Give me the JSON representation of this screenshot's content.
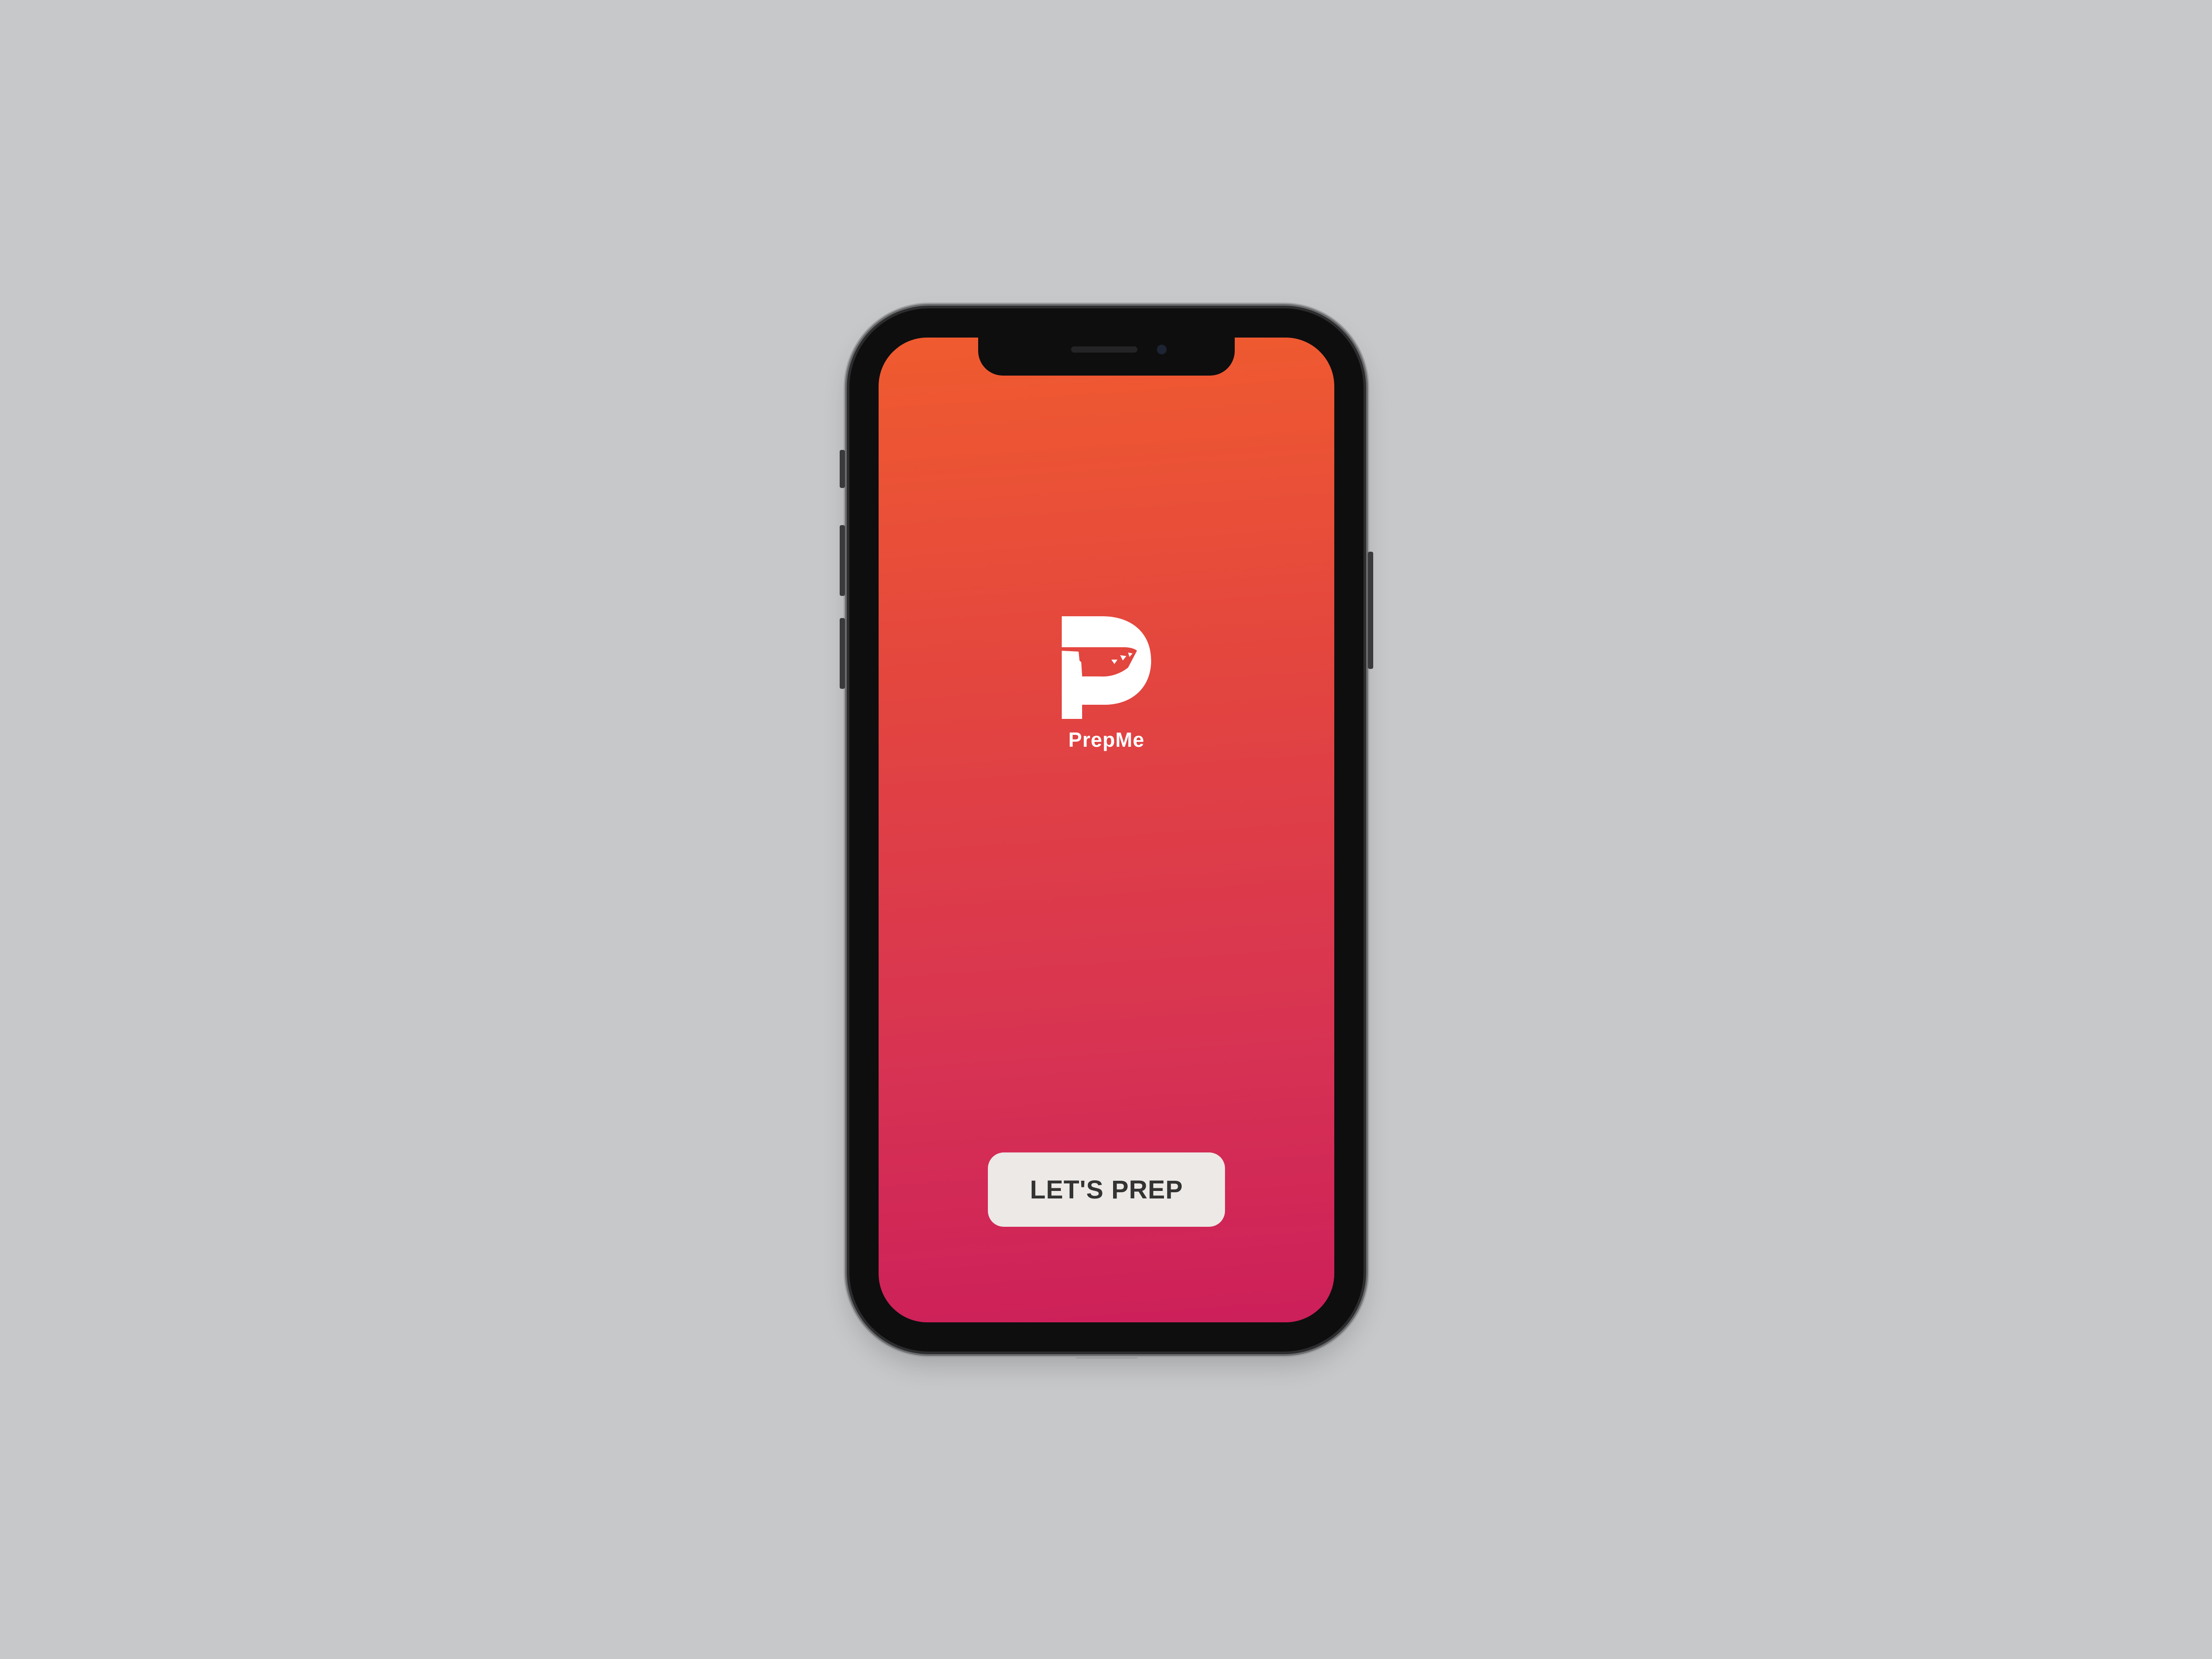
{
  "app": {
    "name": "PrepMe",
    "logo_icon": "prepme-p-logo-icon"
  },
  "cta": {
    "label": "LET'S PREP"
  },
  "colors": {
    "background": "#c7c8ca",
    "gradient_top": "#f05b2f",
    "gradient_bottom": "#cc1f5a",
    "button_bg": "#ece9e6",
    "button_text": "#333333"
  }
}
